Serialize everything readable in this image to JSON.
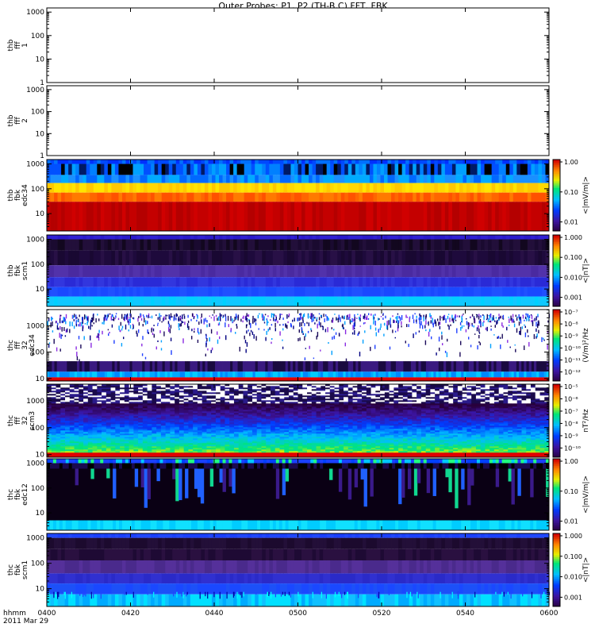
{
  "title": "Outer Probes: P1, P2 (TH-B,C) FFT, FBK",
  "x_axis": {
    "row1_label": "hhmm",
    "row2_label": "2011 Mar 29",
    "ticks": [
      "0400",
      "0420",
      "0440",
      "0500",
      "0520",
      "0540",
      "0600"
    ]
  },
  "colorbar_scales": {
    "a": {
      "ticks": [
        "1.00",
        "0.10",
        "0.01"
      ],
      "exp": [
        0,
        -1,
        -2
      ]
    },
    "b": {
      "ticks": [
        "1.000",
        "0.100",
        "0.010",
        "0.001"
      ],
      "exp": [
        0,
        -1,
        -2,
        -3
      ]
    },
    "c": {
      "ticks": [
        "10⁻⁷",
        "10⁻⁸",
        "10⁻⁹",
        "10⁻¹⁰",
        "10⁻¹¹",
        "10⁻¹²"
      ],
      "exp": [
        -7,
        -8,
        -9,
        -10,
        -11,
        -12
      ]
    },
    "d": {
      "ticks": [
        "10⁻⁵",
        "10⁻⁶",
        "10⁻⁷",
        "10⁻⁸",
        "10⁻⁹",
        "10⁻¹⁰"
      ],
      "exp": [
        -5,
        -6,
        -7,
        -8,
        -9,
        -10
      ]
    }
  },
  "chart_data": [
    {
      "type": "heatmap",
      "panel_id": "p1",
      "ylabel": [
        "thb",
        "fff",
        "1"
      ],
      "y_ticks": [
        "1000",
        "100",
        "10",
        "1"
      ],
      "ylim": [
        1,
        1500
      ],
      "yscale": "log",
      "colorbar": null,
      "empty": true
    },
    {
      "type": "heatmap",
      "panel_id": "p2",
      "ylabel": [
        "thb",
        "fff",
        "2"
      ],
      "y_ticks": [
        "1000",
        "100",
        "10",
        "1"
      ],
      "ylim": [
        1,
        1500
      ],
      "yscale": "log",
      "colorbar": null,
      "empty": true
    },
    {
      "type": "heatmap",
      "panel_id": "p3",
      "ylabel": [
        "thb",
        "fbk",
        "edc34"
      ],
      "y_ticks": [
        "1000",
        "100",
        "10"
      ],
      "ylim": [
        2,
        1500
      ],
      "yscale": "log",
      "colorbar": {
        "label": "<|mV/m|>",
        "scale": "a"
      },
      "style": "fbk_edc",
      "bands": [
        {
          "freq_range": [
            1000,
            1500
          ],
          "colors": [
            "#0048ff",
            "#0070ff",
            "#0030ff"
          ]
        },
        {
          "freq_range": [
            360,
            1000
          ],
          "colors": [
            "#000000",
            "#0050ff",
            "#0080ff",
            "#00a0ff",
            "#001a66"
          ]
        },
        {
          "freq_range": [
            170,
            360
          ],
          "colors": [
            "#00aaff",
            "#1a90ff",
            "#0068ff"
          ]
        },
        {
          "freq_range": [
            70,
            170
          ],
          "colors": [
            "#ffd800",
            "#ffe400",
            "#ffc800"
          ]
        },
        {
          "freq_range": [
            30,
            70
          ],
          "colors": [
            "#ff6600",
            "#ff7a00",
            "#ff5200"
          ]
        },
        {
          "freq_range": [
            2,
            30
          ],
          "colors": [
            "#c40000",
            "#b40000",
            "#d00000"
          ]
        }
      ]
    },
    {
      "type": "heatmap",
      "panel_id": "p4",
      "ylabel": [
        "thb",
        "fbk",
        "scm1"
      ],
      "y_ticks": [
        "1000",
        "100",
        "10"
      ],
      "ylim": [
        2,
        1500
      ],
      "yscale": "log",
      "colorbar": {
        "label": "<|nT|>",
        "scale": "b"
      },
      "style": "fbk_scm",
      "bands": [
        {
          "freq_range": [
            1000,
            1500
          ],
          "colors": [
            "#2a1acc",
            "#3020d4"
          ]
        },
        {
          "freq_range": [
            360,
            1000
          ],
          "colors": [
            "#1a0a30",
            "#220f3a",
            "#12071f"
          ]
        },
        {
          "freq_range": [
            90,
            360
          ],
          "colors": [
            "#1e0a3c",
            "#281046",
            "#190832"
          ]
        },
        {
          "freq_range": [
            30,
            90
          ],
          "colors": [
            "#4a2aa0",
            "#5232aa"
          ]
        },
        {
          "freq_range": [
            12,
            30
          ],
          "colors": [
            "#2a2ad6",
            "#3236de"
          ]
        },
        {
          "freq_range": [
            5,
            12
          ],
          "colors": [
            "#1a48ff",
            "#2050ff"
          ]
        },
        {
          "freq_range": [
            2,
            5
          ],
          "colors": [
            "#00d0ff",
            "#10c8ff"
          ]
        }
      ]
    },
    {
      "type": "heatmap",
      "panel_id": "p5",
      "ylabel": [
        "thc",
        "fff",
        "32",
        "edc34"
      ],
      "y_ticks": [
        "1000",
        "100",
        "10"
      ],
      "ylim": [
        8,
        4096
      ],
      "yscale": "log",
      "colorbar": {
        "label": "(V/m)²/Hz",
        "scale": "c"
      },
      "style": "fff_edc"
    },
    {
      "type": "heatmap",
      "panel_id": "p6",
      "ylabel": [
        "thc",
        "fff",
        "32",
        "scm3"
      ],
      "y_ticks": [
        "1000",
        "100",
        "10"
      ],
      "ylim": [
        8,
        4096
      ],
      "yscale": "log",
      "colorbar": {
        "label": "nT²/Hz",
        "scale": "d"
      },
      "style": "fff_scm"
    },
    {
      "type": "heatmap",
      "panel_id": "p7",
      "ylabel": [
        "thc",
        "fbk",
        "edc12"
      ],
      "y_ticks": [
        "1000",
        "100",
        "10"
      ],
      "ylim": [
        2,
        1500
      ],
      "yscale": "log",
      "colorbar": {
        "label": "<|mV/m|>",
        "scale": "a"
      },
      "style": "fbk_edc12"
    },
    {
      "type": "heatmap",
      "panel_id": "p8",
      "ylabel": [
        "thc",
        "fbk",
        "scm1"
      ],
      "y_ticks": [
        "1000",
        "100",
        "10"
      ],
      "ylim": [
        2,
        1500
      ],
      "yscale": "log",
      "colorbar": {
        "label": "<|nT|>",
        "scale": "b"
      },
      "style": "fbk_scm2",
      "bands": [
        {
          "freq_range": [
            1000,
            1500
          ],
          "colors": [
            "#1a40ff",
            "#2048ff"
          ]
        },
        {
          "freq_range": [
            360,
            1000
          ],
          "colors": [
            "#1c0a2e",
            "#230f38"
          ]
        },
        {
          "freq_range": [
            130,
            360
          ],
          "colors": [
            "#2a1040",
            "#1e0a34"
          ]
        },
        {
          "freq_range": [
            40,
            130
          ],
          "colors": [
            "#4a2a8c",
            "#55309a"
          ]
        },
        {
          "freq_range": [
            16,
            40
          ],
          "colors": [
            "#2a2ac8",
            "#3030d0"
          ]
        },
        {
          "freq_range": [
            6,
            16
          ],
          "colors": [
            "#1a48ff",
            "#1c50f8"
          ]
        },
        {
          "freq_range": [
            2,
            6
          ],
          "colors": [
            "#00aaff",
            "#10c0ff",
            "#00e0ff"
          ]
        }
      ]
    }
  ]
}
